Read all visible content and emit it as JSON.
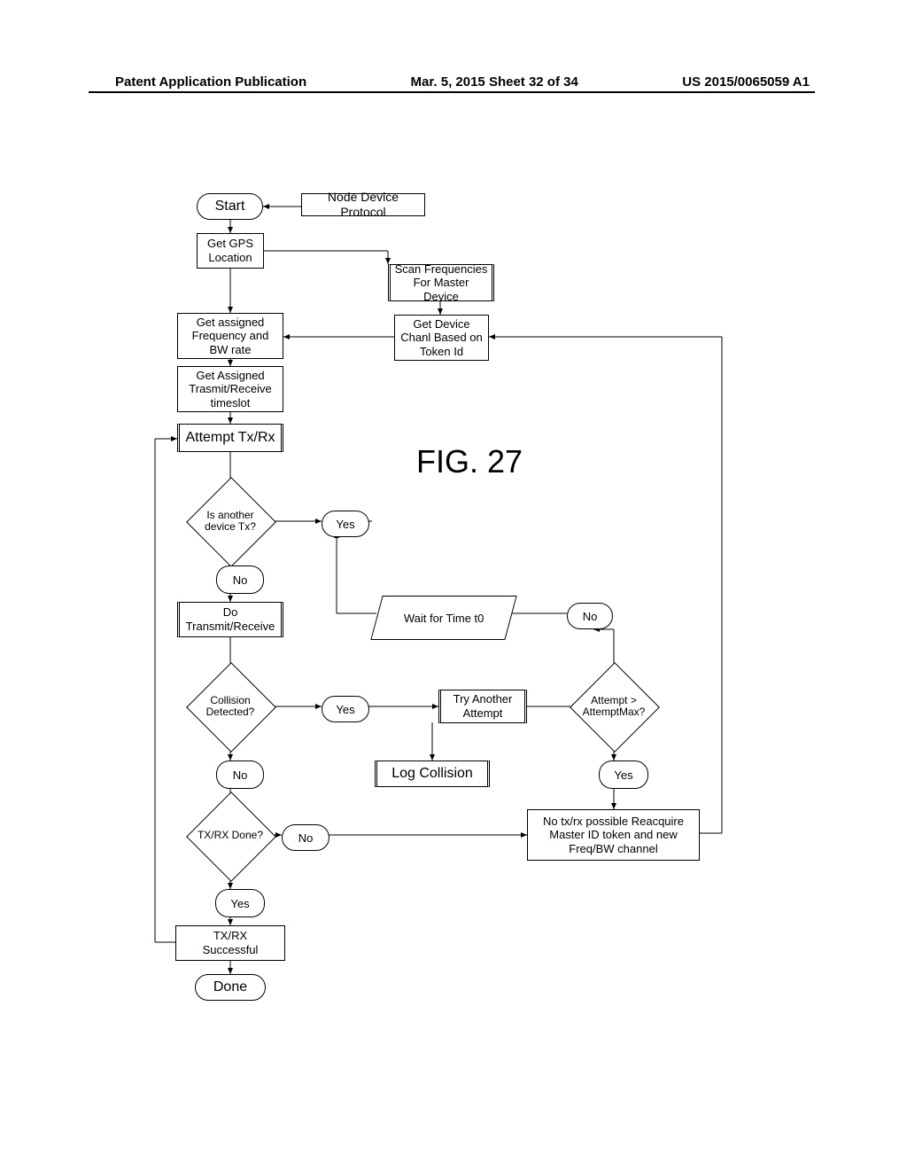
{
  "header": {
    "left": "Patent Application Publication",
    "center": "Mar. 5, 2015  Sheet 32 of 34",
    "right": "US 2015/0065059 A1"
  },
  "figure_label": "FIG. 27",
  "nodes": {
    "start": "Start",
    "node_device_protocol": "Node Device Protocol",
    "get_gps": "Get GPS\nLocation",
    "scan_freq": "Scan Frequencies\nFor Master Device",
    "get_assigned_freq": "Get assigned\nFrequency and\nBW rate",
    "get_device_chanl": "Get Device\nChanl Based on\nToken Id",
    "get_assigned_timeslot": "Get Assigned\nTrasmit/Receive\ntimeslot",
    "attempt_txrx": "Attempt Tx/Rx",
    "is_another_tx": "Is another\ndevice Tx?",
    "yes1": "Yes",
    "no1": "No",
    "do_txrx": "Do\nTransmit/Receive",
    "wait_t0": "Wait for Time t0",
    "collision_detected": "Collision\nDetected?",
    "yes2": "Yes",
    "try_another": "Try Another\nAttempt",
    "attempt_max": "Attempt >\nAttemptMax?",
    "no_max": "No",
    "log_collision": "Log Collision",
    "yes_max": "Yes",
    "no2": "No",
    "txrx_done": "TX/RX Done?",
    "no3": "No",
    "no_txrx_possible": "No tx/rx possible Reacquire\nMaster ID token and new\nFreq/BW channel",
    "yes3": "Yes",
    "txrx_success": "TX/RX\nSuccessful",
    "done": "Done"
  }
}
